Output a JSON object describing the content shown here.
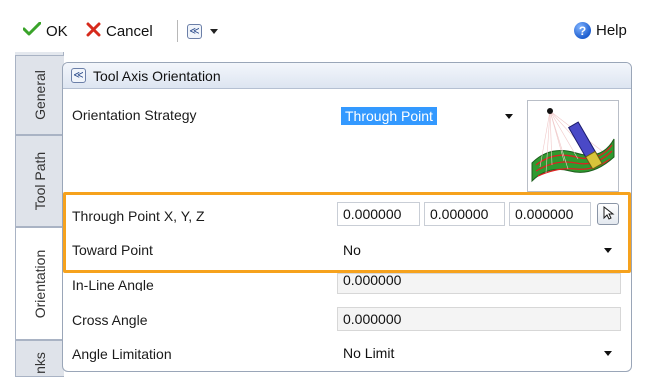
{
  "toolbar": {
    "ok_label": "OK",
    "cancel_label": "Cancel",
    "help_label": "Help"
  },
  "tabs": [
    {
      "label": "General"
    },
    {
      "label": "Tool Path"
    },
    {
      "label": "Orientation"
    },
    {
      "label": "nks"
    }
  ],
  "panel": {
    "title": "Tool Axis Orientation"
  },
  "fields": {
    "orientation_strategy": {
      "label": "Orientation Strategy",
      "value": "Through Point"
    },
    "through_point": {
      "label": "Through Point X, Y, Z",
      "x": "0.000000",
      "y": "0.000000",
      "z": "0.000000"
    },
    "toward_point": {
      "label": "Toward Point",
      "value": "No"
    },
    "in_line_angle": {
      "label": "In-Line Angle",
      "value": "0.000000"
    },
    "cross_angle": {
      "label": "Cross Angle",
      "value": "0.000000"
    },
    "angle_limitation": {
      "label": "Angle Limitation",
      "value": "No Limit"
    }
  },
  "colors": {
    "highlight": "#f6a21d",
    "selection": "#3399ff",
    "ok_check": "#3aa32a",
    "cancel_x": "#d62a1c"
  },
  "icons": {
    "ok": "check-icon",
    "cancel": "x-icon",
    "collapse": "double-chevron-icon",
    "help": "help-icon",
    "pick": "cursor-pick-icon",
    "preview": "tool-axis-preview-image"
  }
}
